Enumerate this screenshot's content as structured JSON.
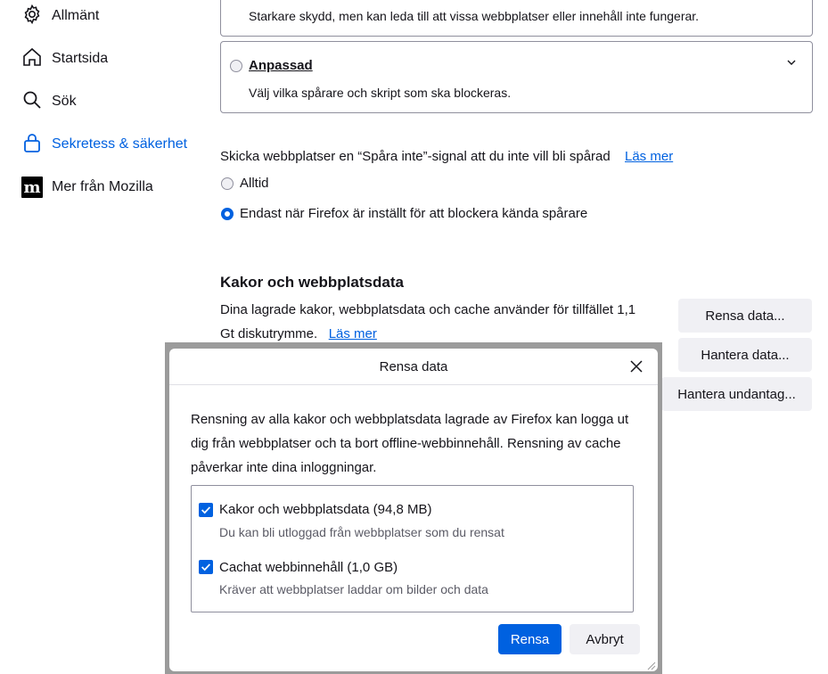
{
  "sidebar": {
    "items": [
      {
        "label": "Allmänt",
        "icon": "gear-icon"
      },
      {
        "label": "Startsida",
        "icon": "home-icon"
      },
      {
        "label": "Sök",
        "icon": "search-icon"
      },
      {
        "label": "Sekretess & säkerhet",
        "icon": "lock-icon",
        "active": true
      },
      {
        "label": "Mer från Mozilla",
        "icon": "mozilla-m-icon"
      }
    ]
  },
  "tracking": {
    "strict_desc": "Starkare skydd, men kan leda till att vissa webbplatser eller innehåll inte fungerar.",
    "custom": {
      "label": "Anpassad",
      "desc": "Välj vilka spårare och skript som ska blockeras."
    },
    "dnt": {
      "text": "Skicka webbplatser en “Spåra inte”-signal att du inte vill bli spårad",
      "learn_more": "Läs mer",
      "options": [
        {
          "label": "Alltid",
          "checked": false
        },
        {
          "label": "Endast när Firefox är inställt för att blockera kända spårare",
          "checked": true
        }
      ]
    }
  },
  "cookies": {
    "title": "Kakor och webbplatsdata",
    "desc_line1": "Dina lagrade kakor, webbplatsdata och cache använder för tillfället 1,1",
    "desc_line2": "Gt diskutrymme.",
    "learn_more": "Läs mer",
    "buttons": {
      "clear": "Rensa data...",
      "manage": "Hantera data...",
      "exceptions": "Hantera undantag..."
    }
  },
  "dialog": {
    "title": "Rensa data",
    "description": "Rensning av alla kakor och webbplatsdata lagrade av Firefox kan logga ut dig från webbplatser och ta bort offline-webbinnehåll. Rensning av cache påverkar inte dina inloggningar.",
    "options": [
      {
        "label": "Kakor och webbplatsdata (94,8 MB)",
        "desc": "Du kan bli utloggad från webbplatser som du rensat",
        "checked": true
      },
      {
        "label": "Cachat webbinnehåll (1,0 GB)",
        "desc": "Kräver att webbplatser laddar om bilder och data",
        "checked": true
      }
    ],
    "clear_button": "Rensa",
    "cancel_button": "Avbryt"
  },
  "colors": {
    "accent": "#0061e0",
    "button_bg": "#f0f0f4",
    "text": "#15141a"
  }
}
